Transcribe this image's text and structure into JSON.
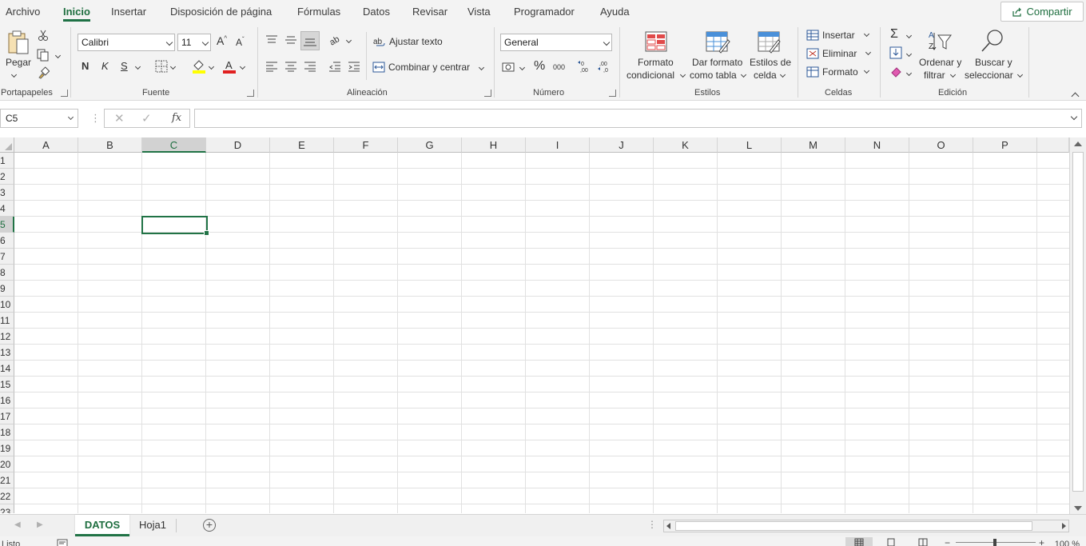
{
  "menu": {
    "tabs": [
      {
        "label": "Archivo"
      },
      {
        "label": "Inicio"
      },
      {
        "label": "Insertar"
      },
      {
        "label": "Disposición de página"
      },
      {
        "label": "Fórmulas"
      },
      {
        "label": "Datos"
      },
      {
        "label": "Revisar"
      },
      {
        "label": "Vista"
      },
      {
        "label": "Programador"
      },
      {
        "label": "Ayuda"
      }
    ],
    "active_tab": "Inicio",
    "share_label": "Compartir"
  },
  "ribbon": {
    "clipboard": {
      "paste_label": "Pegar",
      "group_label": "Portapapeles"
    },
    "font": {
      "font_name": "Calibri",
      "font_size": "11",
      "bold": "N",
      "italic": "K",
      "underline": "S",
      "group_label": "Fuente"
    },
    "alignment": {
      "wrap_label": "Ajustar texto",
      "merge_label": "Combinar y centrar",
      "group_label": "Alineación"
    },
    "number": {
      "format": "General",
      "percent": "%",
      "thousands": "000",
      "group_label": "Número"
    },
    "styles": {
      "conditional_line1": "Formato",
      "conditional_line2": "condicional",
      "table_line1": "Dar formato",
      "table_line2": "como tabla",
      "cellstyles_line1": "Estilos de",
      "cellstyles_line2": "celda",
      "group_label": "Estilos"
    },
    "cells": {
      "insert_label": "Insertar",
      "delete_label": "Eliminar",
      "format_label": "Formato",
      "group_label": "Celdas"
    },
    "editing": {
      "sort_line1": "Ordenar y",
      "sort_line2": "filtrar",
      "find_line1": "Buscar y",
      "find_line2": "seleccionar",
      "group_label": "Edición"
    }
  },
  "formula_bar": {
    "name_box": "C5",
    "fx_label": "fx",
    "formula": ""
  },
  "grid": {
    "columns": [
      "A",
      "B",
      "C",
      "D",
      "E",
      "F",
      "G",
      "H",
      "I",
      "J",
      "K",
      "L",
      "M",
      "N",
      "O",
      "P"
    ],
    "rows": [
      "1",
      "2",
      "3",
      "4",
      "5",
      "6",
      "7",
      "8",
      "9",
      "10",
      "11",
      "12",
      "13",
      "14",
      "15",
      "16",
      "17",
      "18",
      "19",
      "20",
      "21",
      "22",
      "23"
    ],
    "active_cell": "C5",
    "active_column": "C",
    "active_row": "5"
  },
  "sheets": {
    "tabs": [
      {
        "label": "DATOS"
      },
      {
        "label": "Hoja1"
      }
    ],
    "active": "DATOS"
  },
  "status": {
    "ready": "Listo",
    "zoom": "100 %"
  },
  "colors": {
    "accent": "#217346",
    "accent_text": "#1e6e3f",
    "ribbon_bg": "#f3f3f3"
  }
}
